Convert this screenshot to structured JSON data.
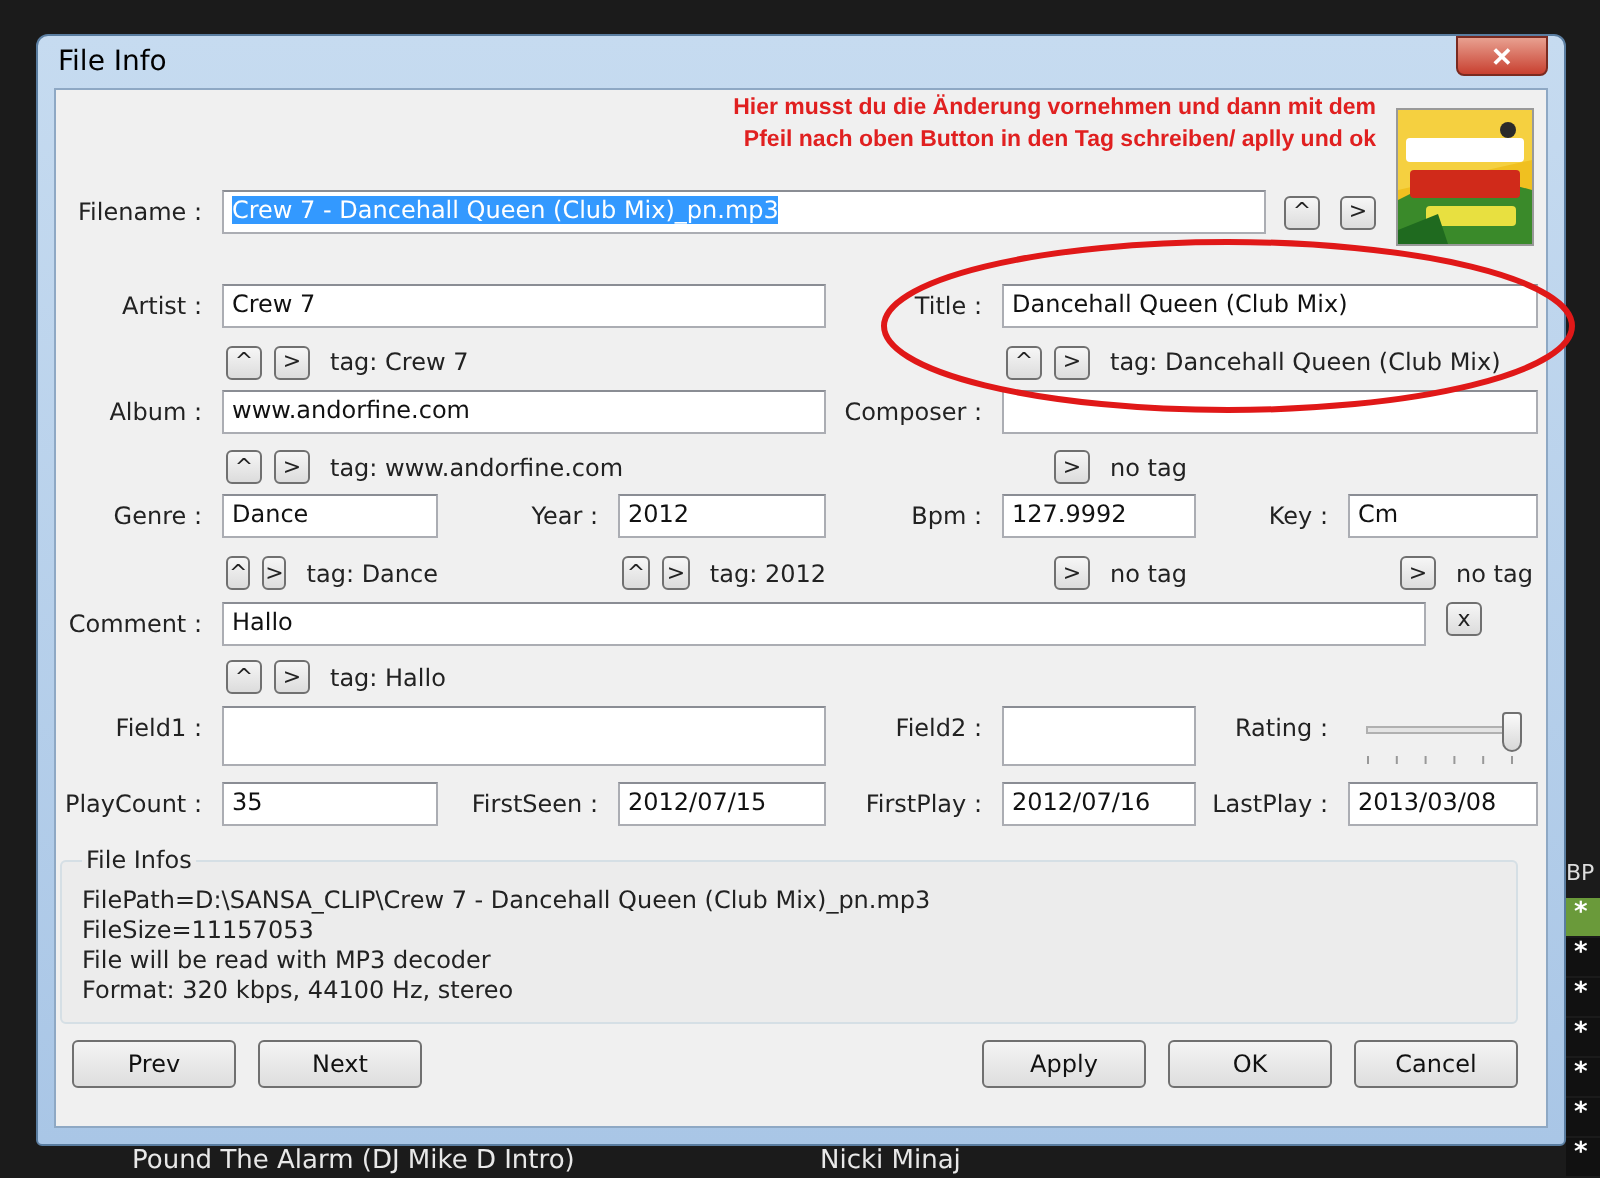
{
  "window": {
    "title": "File Info",
    "close": "✕"
  },
  "note": [
    "Hier musst du die Änderung vornehmen und dann mit dem",
    "Pfeil nach oben Button in den Tag schreiben/ aplly und ok"
  ],
  "filename": {
    "label": "Filename :",
    "value": "Crew 7 - Dancehall Queen (Club Mix)_pn.mp3",
    "selected": true,
    "buttons": [
      "^",
      ">"
    ]
  },
  "cover": {
    "kind": "picture"
  },
  "fields": [
    {
      "label": "Artist :",
      "value": "Crew 7",
      "buttons": [
        "^",
        ">"
      ],
      "tag": "tag: Crew 7"
    },
    {
      "label": "Title :",
      "value": "Dancehall Queen (Club Mix)",
      "buttons": [
        "^",
        ">"
      ],
      "tag": "tag: Dancehall Queen (Club Mix)"
    },
    {
      "label": "Album :",
      "value": "www.andorfine.com",
      "buttons": [
        "^",
        ">"
      ],
      "tag": "tag: www.andorfine.com"
    },
    {
      "label": "Composer :",
      "buttons": [
        ">"
      ],
      "tag": "no tag"
    },
    {
      "label": "Genre :",
      "value": "Dance",
      "buttons": [
        "^",
        ">"
      ],
      "tag": "tag: Dance"
    },
    {
      "label": "Year :",
      "value": "2012",
      "buttons": [
        "^",
        ">"
      ],
      "tag": "tag: 2012"
    },
    {
      "label": "Bpm :",
      "value": "127.9992",
      "buttons": [
        ">"
      ],
      "tag": "no tag"
    },
    {
      "label": "Key :",
      "value": "Cm",
      "buttons": [
        ">"
      ],
      "tag": "no tag"
    },
    {
      "label": "Comment :",
      "value": "Hallo",
      "buttons": [
        "^",
        ">"
      ],
      "tag": "tag: Hallo",
      "clear": "x"
    },
    {
      "label": "Field1 :"
    },
    {
      "label": "Field2 :"
    },
    {
      "label": "Rating :",
      "kind": "slider",
      "level": 1
    },
    {
      "label": "PlayCount :",
      "value": "35"
    },
    {
      "label": "FirstSeen :",
      "value": "2012/07/15"
    },
    {
      "label": "FirstPlay :",
      "value": "2012/07/16"
    },
    {
      "label": "LastPlay :",
      "value": "2013/03/08"
    }
  ],
  "file_infos": {
    "title": "File Infos",
    "lines": [
      "FilePath=D:\\SANSA_CLIP\\Crew 7 - Dancehall Queen (Club Mix)_pn.mp3",
      "FileSize=11157053",
      "File will be read with MP3 decoder",
      "Format: 320 kbps, 44100 Hz, stereo"
    ]
  },
  "buttons_left": [
    "Prev",
    "Next"
  ],
  "buttons_right": [
    "Apply",
    "OK",
    "Cancel"
  ],
  "background": {
    "track": [
      "Pound The Alarm (DJ Mike D Intro)",
      "Nicki Minaj"
    ],
    "column_header": "BP",
    "marks": [
      {
        "text": "*",
        "selected": true
      },
      {
        "text": "*",
        "selected": false
      },
      {
        "text": "*",
        "selected": false
      },
      {
        "text": "*",
        "selected": false
      },
      {
        "text": "*",
        "selected": false
      },
      {
        "text": "*",
        "selected": false
      },
      {
        "text": "*",
        "selected": false
      }
    ]
  }
}
